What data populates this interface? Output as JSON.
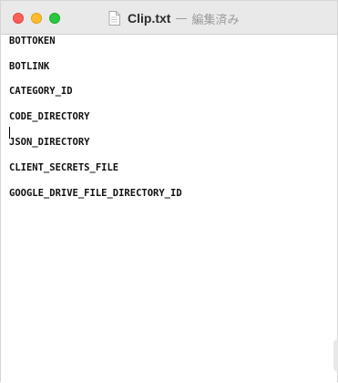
{
  "window": {
    "title": "Clip.txt",
    "separator": "—",
    "status": "編集済み"
  },
  "traffic_lights": {
    "close": "#ff5f57",
    "minimize": "#febc2e",
    "zoom": "#28c840"
  },
  "icons": {
    "document": "document-icon"
  },
  "editor": {
    "lines": [
      "BOTTOKEN",
      "BOTLINK",
      "CATEGORY_ID",
      "CODE_DIRECTORY",
      "JSON_DIRECTORY",
      "CLIENT_SECRETS_FILE",
      "GOOGLE_DRIVE_FILE_DIRECTORY_ID"
    ]
  }
}
